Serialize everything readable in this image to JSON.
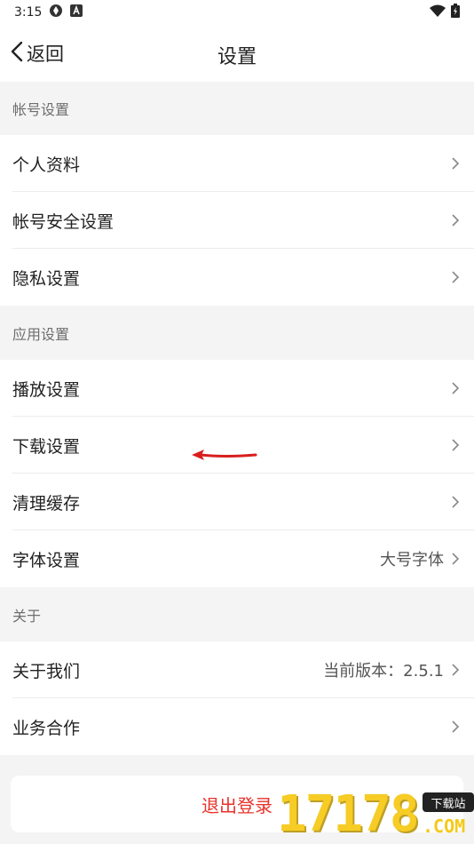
{
  "status_bar": {
    "time": "3:15"
  },
  "header": {
    "back_label": "返回",
    "title": "设置"
  },
  "sections": {
    "account": {
      "title": "帐号设置",
      "items": [
        {
          "label": "个人资料"
        },
        {
          "label": "帐号安全设置"
        },
        {
          "label": "隐私设置"
        }
      ]
    },
    "app": {
      "title": "应用设置",
      "items": [
        {
          "label": "播放设置"
        },
        {
          "label": "下载设置"
        },
        {
          "label": "清理缓存"
        },
        {
          "label": "字体设置",
          "value": "大号字体"
        }
      ]
    },
    "about": {
      "title": "关于",
      "items": [
        {
          "label": "关于我们",
          "value": "当前版本：2.5.1"
        },
        {
          "label": "业务合作"
        }
      ]
    }
  },
  "logout_label": "退出登录",
  "watermark": {
    "digits": "17178",
    "tag": "下载站",
    "domain": ".COM"
  },
  "colors": {
    "accent": "#e8322a",
    "background": "#f4f4f4",
    "annotation_arrow": "#d81e1e"
  }
}
